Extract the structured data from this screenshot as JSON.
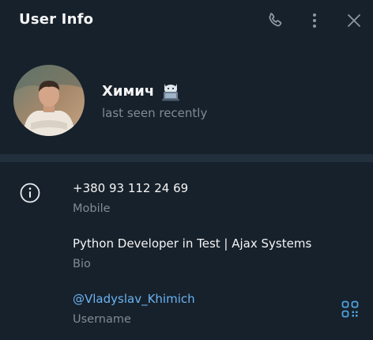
{
  "header": {
    "title": "User Info",
    "icons": [
      "phone-icon",
      "more-vertical-icon",
      "close-icon"
    ]
  },
  "profile": {
    "name": "Химич",
    "status": "last seen recently",
    "emoji_status": "cat-with-laptop-emoji"
  },
  "info": {
    "phone": {
      "value": "+380 93 112 24 69",
      "label": "Mobile"
    },
    "bio": {
      "value": "Python Developer in Test | Ajax Systems",
      "label": "Bio"
    },
    "username": {
      "value": "@Vladyslav_Khimich",
      "label": "Username"
    }
  },
  "colors": {
    "background": "#17212b",
    "divider": "#222f3d",
    "muted": "#7f8b96",
    "link": "#6ab3f3",
    "accent": "#4fa3e0"
  }
}
